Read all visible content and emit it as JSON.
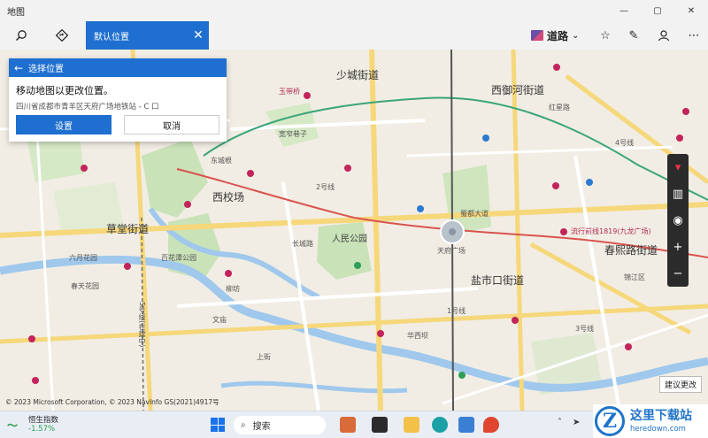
{
  "window": {
    "title": "地图"
  },
  "toolbar": {
    "search_value": "默认位置",
    "map_style": "道路"
  },
  "card": {
    "header": "选择位置",
    "heading": "移动地图以更改位置。",
    "address": "四川省成都市青羊区天府广场地铁站 - C 口",
    "set_button": "设置",
    "cancel_button": "取消"
  },
  "map": {
    "labels": {
      "shaocheng": "少城街道",
      "xiyu": "西御河街道",
      "xijiaochang": "西校场",
      "caotang": "草堂街道",
      "chunxi": "春熙路街道",
      "yanshikou": "盐市口街道",
      "renmin_park": "人民公园",
      "line2": "2号线",
      "line4": "4号线",
      "line5": "5号线(在建中)",
      "line3": "3号线",
      "line1": "1号线",
      "tianfu": "天府广场",
      "shudu": "蜀都大道",
      "liuyuan": "六月花园",
      "baihuatan": "百花潭公园",
      "kuanzhai": "宽窄巷子",
      "jinhe": "锦江区",
      "yuhe": "玉带桥",
      "chunyi": "春天花园",
      "hongxing": "红星路",
      "longying": "流行前线1819(九龙广场)",
      "huaxi": "华西坝",
      "dongcheng": "东城根",
      "liufang": "柳坊",
      "changcheng": "长城路",
      "shangjie": "上街",
      "wenmiao": "文庙"
    },
    "copyright": "© 2023 Microsoft Corporation, © 2023 NavInfo GS(2021)4917号",
    "suggest_button": "建议更改"
  },
  "taskbar": {
    "stock_name": "恒生指数",
    "stock_change": "-1.57%",
    "search_label": "搜索"
  },
  "watermark": {
    "title": "这里下载站",
    "url": "heredown.com"
  },
  "colors": {
    "accent": "#1f6fd0",
    "park": "#c9e2b8",
    "water": "#9fc8ec",
    "main_road": "#f6d77a",
    "metro_green": "#3aa57a"
  }
}
